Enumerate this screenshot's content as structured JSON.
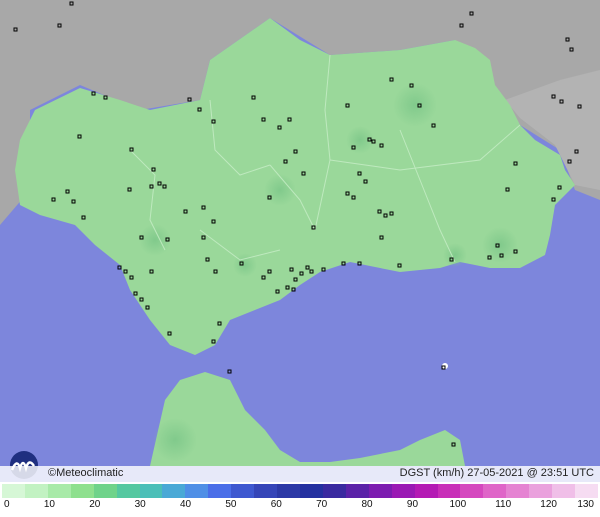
{
  "footer": {
    "copyright": "©Meteoclimatic",
    "product": "DGST (km/h)   27-05-2021 @ 23:51 UTC"
  },
  "legend": {
    "unit_ticks": [
      "0",
      "10",
      "20",
      "30",
      "40",
      "50",
      "60",
      "70",
      "80",
      "90",
      "100",
      "110",
      "120",
      "130"
    ],
    "colors": [
      "#d6f7d6",
      "#c2f2c2",
      "#a8eaa8",
      "#8ee08e",
      "#6fd38a",
      "#55c8a0",
      "#4bbfb8",
      "#4aa9d6",
      "#4f8fe6",
      "#4a6ee8",
      "#3e58d0",
      "#3545b8",
      "#2c39a6",
      "#2531a0",
      "#3a2aa0",
      "#5b22a8",
      "#7c1cb0",
      "#9a19b4",
      "#b41ab4",
      "#c82eb8",
      "#d548bf",
      "#df65c8",
      "#e583d2",
      "#eaa1dd",
      "#f0bfe8",
      "#f6dcf2"
    ]
  },
  "colors": {
    "sea": "#7d86dc",
    "land_andalusia": "#9ad89a",
    "land_outside": "#a9a9a9",
    "land_africa": "#9ad89a"
  }
}
